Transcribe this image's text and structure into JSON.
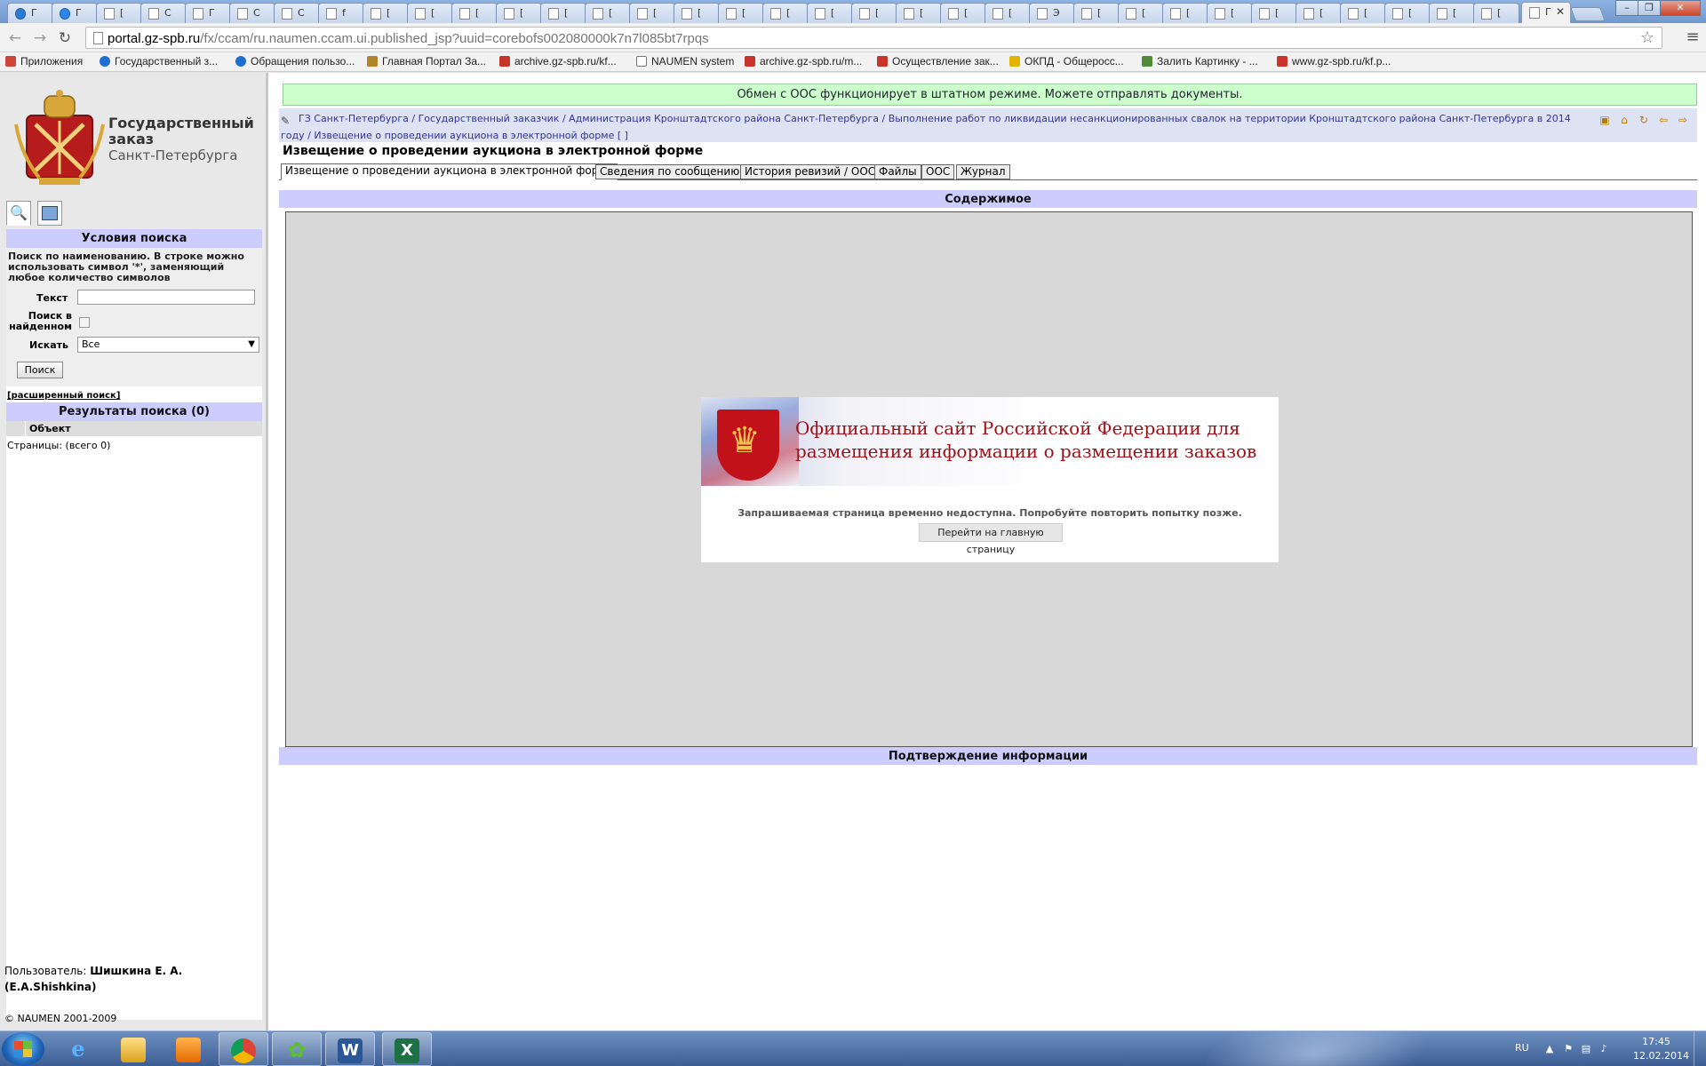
{
  "browser": {
    "tabs": [
      {
        "label": "Г"
      },
      {
        "label": "Г"
      },
      {
        "label": "["
      },
      {
        "label": "С"
      },
      {
        "label": "Г"
      },
      {
        "label": "С"
      },
      {
        "label": "С"
      },
      {
        "label": "f"
      },
      {
        "label": "["
      },
      {
        "label": "["
      },
      {
        "label": "["
      },
      {
        "label": "["
      },
      {
        "label": "["
      },
      {
        "label": "["
      },
      {
        "label": "["
      },
      {
        "label": "["
      },
      {
        "label": "["
      },
      {
        "label": "["
      },
      {
        "label": "["
      },
      {
        "label": "["
      },
      {
        "label": "["
      },
      {
        "label": "["
      },
      {
        "label": "["
      },
      {
        "label": "Э"
      },
      {
        "label": "["
      },
      {
        "label": "["
      },
      {
        "label": "["
      },
      {
        "label": "["
      },
      {
        "label": "["
      },
      {
        "label": "["
      },
      {
        "label": "["
      },
      {
        "label": "["
      },
      {
        "label": "["
      },
      {
        "label": "["
      }
    ],
    "active_tab": {
      "label": "Г"
    },
    "url_domain": "portal.gz-spb.ru",
    "url_path": "/fx/ccam/ru.naumen.ccam.ui.published_jsp?uuid=corebofs002080000k7n7l085bt7rpqs",
    "bookmarks": [
      {
        "label": "Приложения",
        "icon": "apps-grid-icon",
        "color": "#d0453b"
      },
      {
        "label": "Государственный з...",
        "icon": "globe-icon",
        "color": "#1f6fd0"
      },
      {
        "label": "Обращения пользо...",
        "icon": "globe-icon",
        "color": "#1f6fd0"
      },
      {
        "label": "Главная Портал За...",
        "icon": "emblem-icon",
        "color": "#b3832a"
      },
      {
        "label": "archive.gz-spb.ru/kf...",
        "icon": "spb-icon",
        "color": "#c8342a"
      },
      {
        "label": "NAUMEN system",
        "icon": "page-icon",
        "color": "#ffffff"
      },
      {
        "label": "archive.gz-spb.ru/m...",
        "icon": "spb-icon",
        "color": "#c8342a"
      },
      {
        "label": "Осуществление зак...",
        "icon": "flag-icon",
        "color": "#c8342a"
      },
      {
        "label": "ОКПД - Общеросс...",
        "icon": "k-icon",
        "color": "#e0b400"
      },
      {
        "label": "Залить Картинку - ...",
        "icon": "image-icon",
        "color": "#4e8a3a"
      },
      {
        "label": "www.gz-spb.ru/kf.p...",
        "icon": "spb-icon",
        "color": "#c8342a"
      }
    ]
  },
  "left": {
    "logo": {
      "line1": "Государственный",
      "line2": "заказ",
      "line3": "Санкт-Петербурга"
    },
    "search": {
      "title": "Условия поиска",
      "help": "Поиск по наименованию. В строке можно использовать символ '*', заменяющий любое количество символов",
      "text_label": "Текст",
      "text_value": "",
      "in_found_label": "Поиск в найденном",
      "search_in_label": "Искать",
      "search_in_value": "Все",
      "button": "Поиск",
      "advanced": "[расширенный поиск]"
    },
    "results": {
      "title": "Результаты поиска (0)",
      "column": "Объект",
      "pages": "Страницы:  (всего 0)"
    },
    "user": {
      "prefix": "Пользователь:",
      "name": "Шишкина Е. А.",
      "login": "(E.A.Shishkina)"
    },
    "copyright": "© NAUMEN 2001-2009"
  },
  "main": {
    "status_banner": "Обмен с ООС функционирует в штатном режиме. Можете отправлять документы.",
    "breadcrumb": "ГЗ Санкт-Петербурга / Государственный заказчик / Администрация Кронштадтского района Санкт-Петербурга / Выполнение работ по ликвидации несанкционированных свалок на территории Кронштадтского района Санкт-Петербурга в 2014 году / Извещение о проведении аукциона в электронной форме [ ]",
    "page_title": "Извещение о проведении аукциона в электронной форме",
    "tabs": [
      {
        "label": "Извещение о проведении аукциона в электронной форме"
      },
      {
        "label": "Сведения по сообщению"
      },
      {
        "label": "История ревизий / ООС"
      },
      {
        "label": "Файлы"
      },
      {
        "label": "ООС"
      },
      {
        "label": "Журнал"
      }
    ],
    "content_head": "Содержимое",
    "confirm_head": "Подтверждение информации",
    "embedded": {
      "title_line1": "Официальный сайт Российской Федерации для",
      "title_line2": "размещения информации о размещении заказов",
      "message": "Запрашиваемая страница временно недоступна. Попробуйте повторить попытку позже.",
      "button": "Перейти на главную страницу"
    }
  },
  "taskbar": {
    "lang": "RU",
    "time": "17:45",
    "date": "12.02.2014"
  },
  "colors": {
    "header_blue": "#ccccff",
    "status_green": "#ccffcc",
    "breadcrumb_link": "#333399",
    "oos_red": "#a01018"
  }
}
